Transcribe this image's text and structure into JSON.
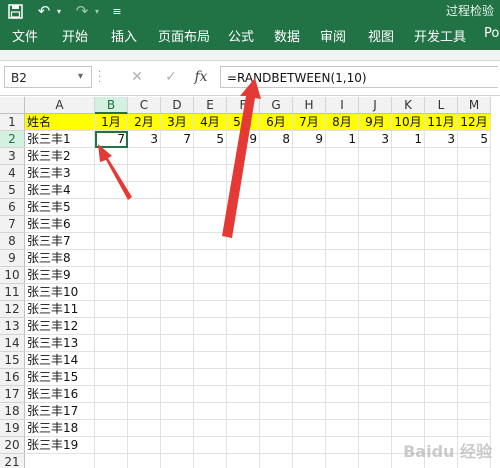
{
  "titlebar": {
    "title": "过程检验"
  },
  "ribbon": {
    "tabs": [
      "文件",
      "开始",
      "插入",
      "页面布局",
      "公式",
      "数据",
      "审阅",
      "视图",
      "开发工具",
      "Pow"
    ]
  },
  "formula_bar": {
    "name_box": "B2",
    "formula": "=RANDBETWEEN(1,10)",
    "fx_label": "fx"
  },
  "sheet": {
    "columns": [
      "A",
      "B",
      "C",
      "D",
      "E",
      "F",
      "G",
      "H",
      "I",
      "J",
      "K",
      "L",
      "M"
    ],
    "rows": [
      "1",
      "2",
      "3",
      "4",
      "5",
      "6",
      "7",
      "8",
      "9",
      "10",
      "11",
      "12",
      "13",
      "14",
      "15",
      "16",
      "17",
      "18",
      "19",
      "20",
      "21",
      "22"
    ],
    "header_row": [
      "姓名",
      "1月",
      "2月",
      "3月",
      "4月",
      "5月",
      "6月",
      "7月",
      "8月",
      "9月",
      "10月",
      "11月",
      "12月"
    ],
    "names": [
      "张三丰1",
      "张三丰2",
      "张三丰3",
      "张三丰4",
      "张三丰5",
      "张三丰6",
      "张三丰7",
      "张三丰8",
      "张三丰9",
      "张三丰10",
      "张三丰11",
      "张三丰12",
      "张三丰13",
      "张三丰14",
      "张三丰15",
      "张三丰16",
      "张三丰17",
      "张三丰18",
      "张三丰19"
    ],
    "row2_values": [
      "7",
      "3",
      "7",
      "5",
      "9",
      "8",
      "9",
      "1",
      "3",
      "1",
      "3",
      "5"
    ],
    "selected_cell": "B2"
  },
  "colors": {
    "excel_green": "#217346",
    "header_fill": "#ffff00",
    "arrow_red": "#e53935"
  },
  "watermark": "Baidu 经验"
}
